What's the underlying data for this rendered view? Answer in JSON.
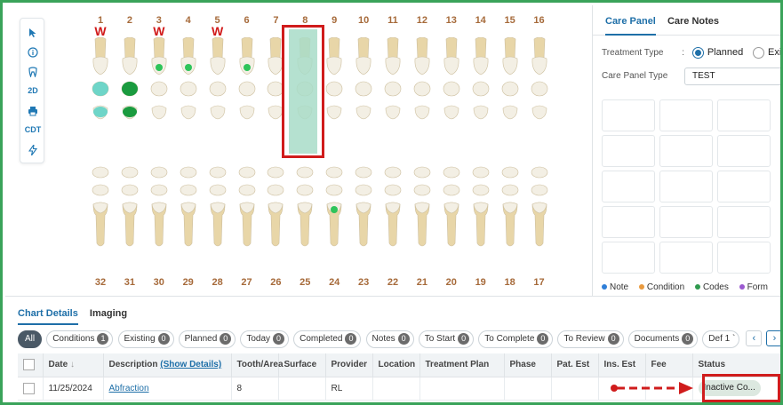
{
  "upper_teeth": [
    "1",
    "2",
    "3",
    "4",
    "5",
    "6",
    "7",
    "8",
    "9",
    "10",
    "11",
    "12",
    "13",
    "14",
    "15",
    "16"
  ],
  "lower_teeth": [
    "32",
    "31",
    "30",
    "29",
    "28",
    "27",
    "26",
    "25",
    "24",
    "23",
    "22",
    "21",
    "20",
    "19",
    "18",
    "17"
  ],
  "w_marks": {
    "1": "W",
    "3": "W",
    "5": "W"
  },
  "selected_tooth": "8",
  "toolbar": {
    "items": [
      {
        "name": "cursor-icon",
        "label": ""
      },
      {
        "name": "info-icon",
        "label": ""
      },
      {
        "name": "tooth-icon",
        "label": ""
      },
      {
        "name": "view-2d-button",
        "label": "2D"
      },
      {
        "name": "print-icon",
        "label": ""
      },
      {
        "name": "cdt-button",
        "label": "CDT"
      },
      {
        "name": "lightning-icon",
        "label": ""
      }
    ]
  },
  "right_panel": {
    "tabs": [
      "Care Panel",
      "Care Notes"
    ],
    "treatment_type_label": "Treatment Type",
    "treatment_type_options": [
      "Planned",
      "Exis"
    ],
    "care_panel_type_label": "Care Panel Type",
    "care_panel_type_value": "TEST",
    "colon": ":",
    "legend": [
      {
        "label": "Note",
        "color": "#2f7fd8"
      },
      {
        "label": "Condition",
        "color": "#e99a3f"
      },
      {
        "label": "Codes",
        "color": "#2f9a4e"
      },
      {
        "label": "Form",
        "color": "#9b59d0"
      }
    ]
  },
  "bottom": {
    "tabs": [
      "Chart Details",
      "Imaging"
    ],
    "filters": [
      {
        "label": "All",
        "count": ""
      },
      {
        "label": "Conditions",
        "count": "1"
      },
      {
        "label": "Existing",
        "count": "0"
      },
      {
        "label": "Planned",
        "count": "0"
      },
      {
        "label": "Today",
        "count": "0"
      },
      {
        "label": "Completed",
        "count": "0"
      },
      {
        "label": "Notes",
        "count": "0"
      },
      {
        "label": "To Start",
        "count": "0"
      },
      {
        "label": "To Complete",
        "count": "0"
      },
      {
        "label": "To Review",
        "count": "0"
      },
      {
        "label": "Documents",
        "count": "0"
      },
      {
        "label": "Def 1 `",
        "count": ""
      }
    ],
    "columns": [
      "",
      "Date",
      "Description",
      "(Show Details)",
      "Tooth/Area",
      "Surface",
      "Provider",
      "Location",
      "Treatment Plan",
      "Phase",
      "Pat. Est",
      "Ins. Est",
      "Fee",
      "Status"
    ],
    "row": {
      "date": "11/25/2024",
      "description": "Abfraction",
      "tooth_area": "8",
      "surface": "",
      "provider": "RL",
      "location": "",
      "treatment_plan": "",
      "phase": "",
      "pat_est": "",
      "ins_est": "",
      "fee": "",
      "status": "Inactive Co..."
    }
  },
  "colors": {
    "accent": "#1e6fa8",
    "highlight_border": "#d01c1c",
    "frame_border": "#3aa35a"
  }
}
